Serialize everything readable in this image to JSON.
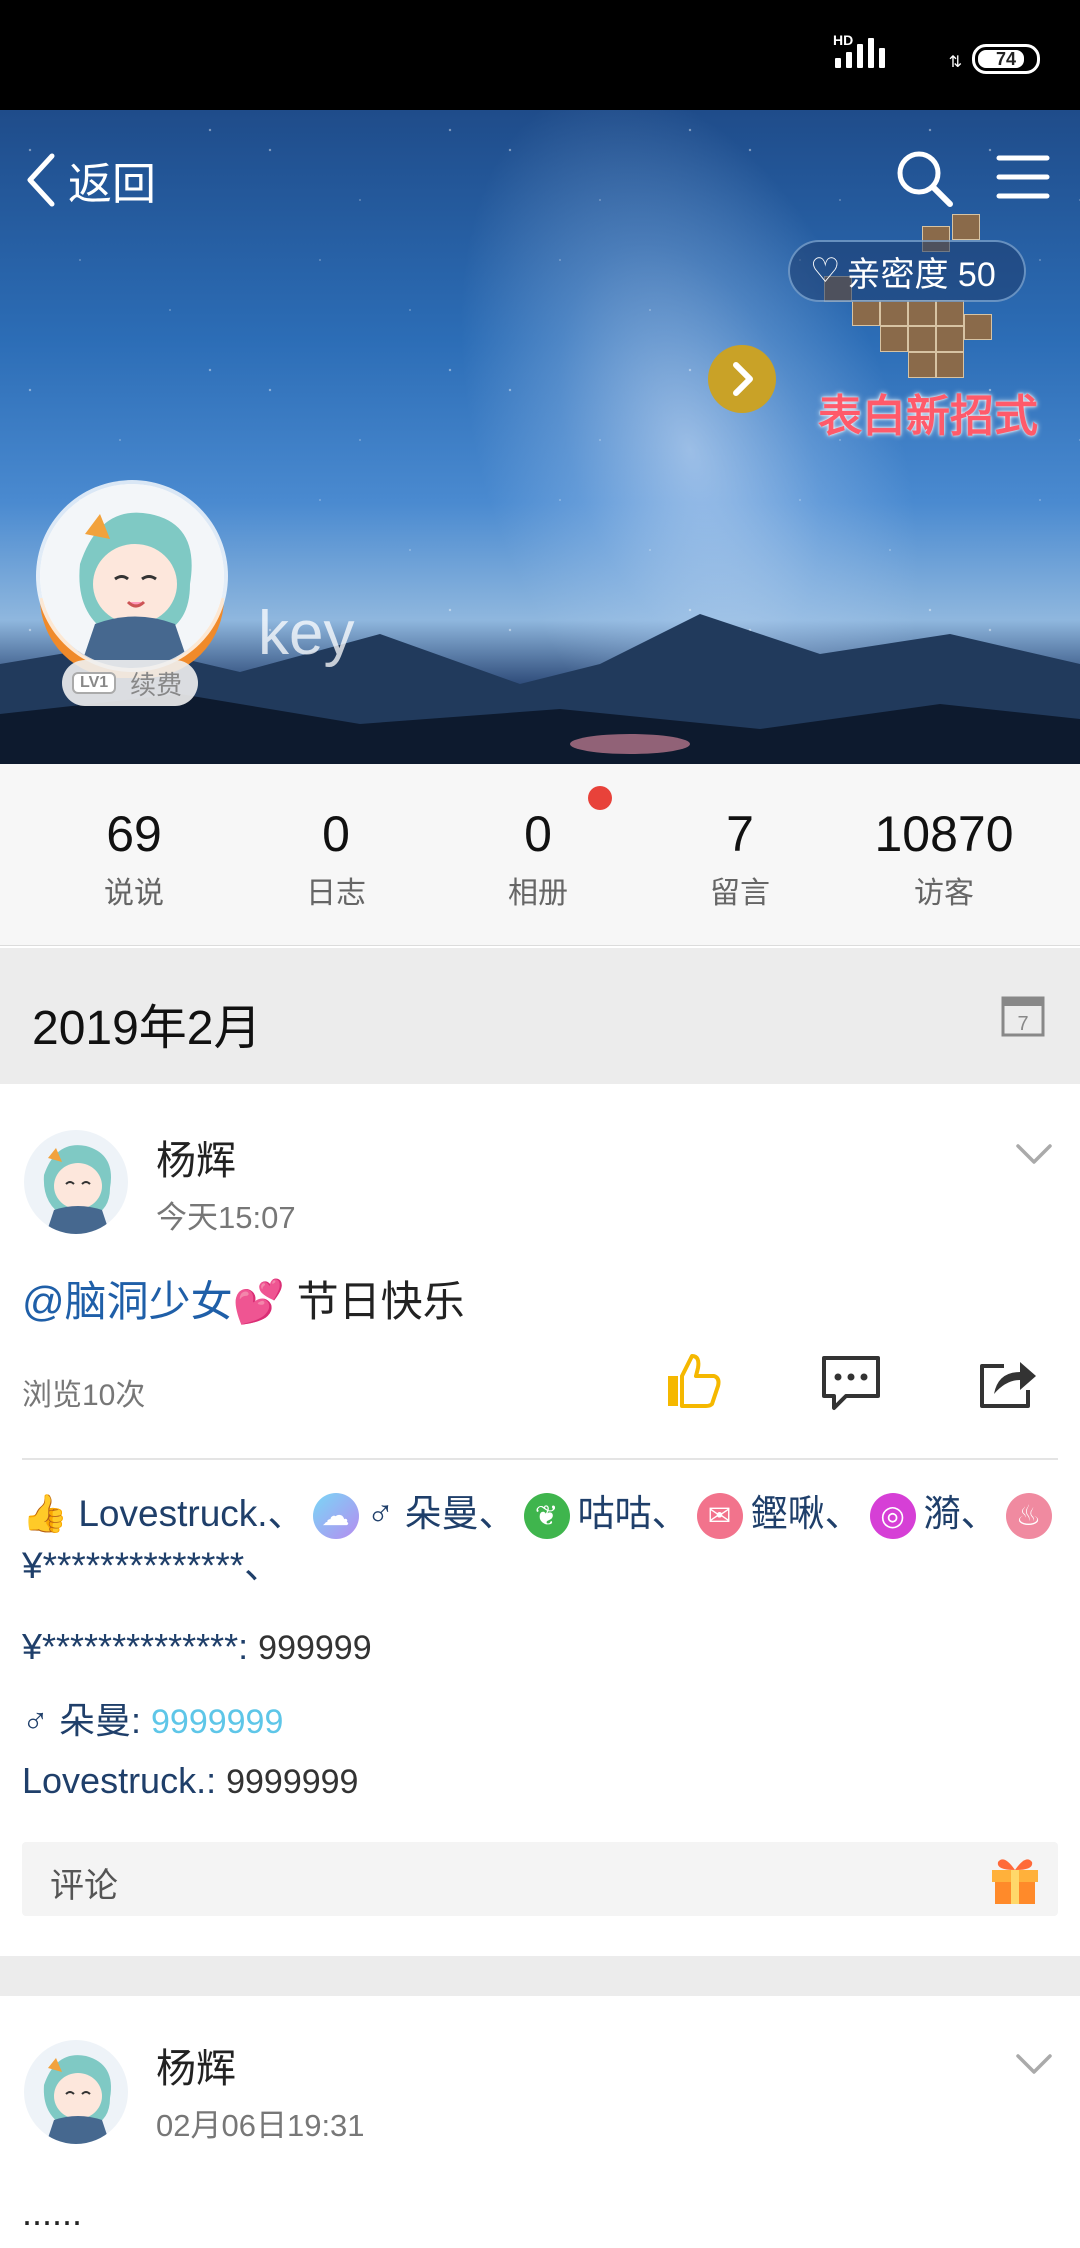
{
  "status_bar": {
    "network": "HD",
    "battery": "74"
  },
  "header": {
    "back_label": "返回",
    "intimacy_label": "亲密度 50",
    "promo_text": "表白新招式",
    "nickname": "key",
    "vip_level": "LV1",
    "renew_label": "续费"
  },
  "stats": [
    {
      "value": "69",
      "label": "说说"
    },
    {
      "value": "0",
      "label": "日志"
    },
    {
      "value": "0",
      "label": "相册"
    },
    {
      "value": "7",
      "label": "留言"
    },
    {
      "value": "10870",
      "label": "访客"
    }
  ],
  "month": "2019年2月",
  "posts": [
    {
      "author": "杨辉",
      "time": "今天15:07",
      "mention": "@脑洞少女",
      "emoji": "💕",
      "text": " 节日快乐",
      "views": "浏览10次",
      "likes": {
        "user1": "Lovestruck.、",
        "user2": "♂ 朵曼、",
        "user3": "咕咕、",
        "user4": "鏗啾、",
        "user5": "漪、",
        "user6": "¥**************、"
      },
      "comments": [
        {
          "author": "¥**************: ",
          "value": "999999"
        },
        {
          "author": "♂ 朵曼: ",
          "value": "9999999"
        },
        {
          "author": "Lovestruck.: ",
          "value": "9999999"
        }
      ],
      "comment_placeholder": "评论"
    },
    {
      "author": "杨辉",
      "time": "02月06日19:31",
      "text": "......"
    }
  ],
  "colors": {
    "accent": "#1f5fa8",
    "like": "#f5b800",
    "dot": "#e8423a"
  }
}
